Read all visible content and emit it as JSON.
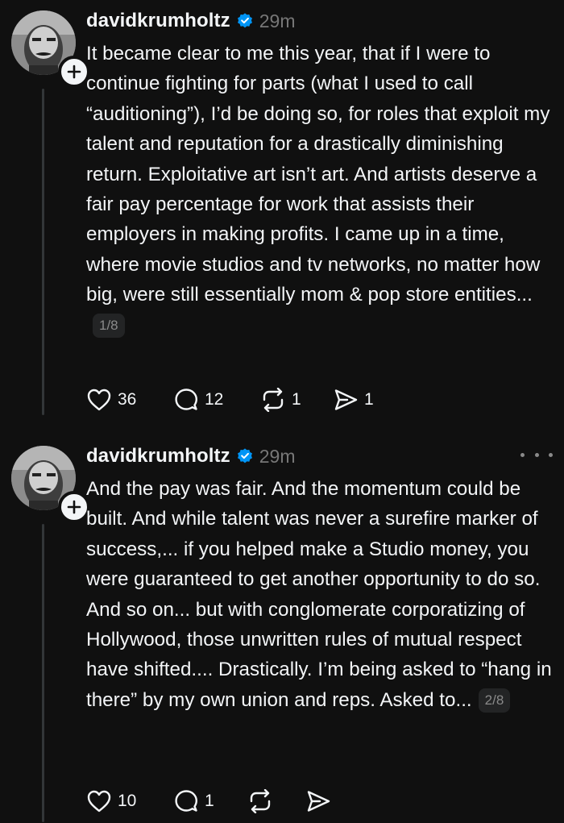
{
  "posts": [
    {
      "username": "davidkrumholtz",
      "time": "29m",
      "text": "It became clear to me this year, that if I were to continue fighting for parts (what I used to call “auditioning”), I’d be doing so, for roles that exploit my talent and reputation for a drastically diminishing return. Exploitative art isn’t art. And artists deserve a fair pay percentage for work that assists their employers in making profits. I came up in a time, where movie studios and tv networks, no matter how big, were still essentially mom & pop store entities...",
      "page": "1/8",
      "likes": "36",
      "replies": "12",
      "reposts": "1",
      "shares": "1",
      "show_more": false
    },
    {
      "username": "davidkrumholtz",
      "time": "29m",
      "text": "And the pay was fair. And the momentum could be built. And while talent was never a surefire marker of success,... if you helped make a Studio money, you were guaranteed to get another opportunity to do so. And so on... but with conglomerate corporatizing of Hollywood, those unwritten rules of mutual respect have shifted.... Drastically. I’m being asked to “hang in there” by my own union and reps. Asked to...",
      "page": "2/8",
      "likes": "10",
      "replies": "1",
      "reposts": "",
      "shares": "",
      "show_more": true
    }
  ],
  "icons": {
    "verified": "verified-badge-icon",
    "follow": "plus-icon",
    "like": "heart-icon",
    "reply": "comment-icon",
    "repost": "repost-icon",
    "share": "send-icon",
    "more": "more-icon"
  },
  "colors": {
    "background": "#101010",
    "text": "#f3f5f7",
    "muted": "#777777",
    "verified": "#0095f6"
  }
}
